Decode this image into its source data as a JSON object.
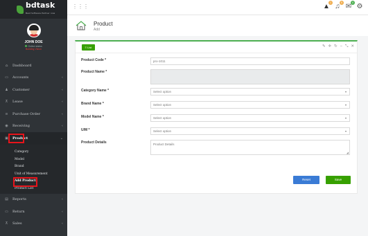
{
  "app": {
    "logo_text": "bdtask",
    "logo_subtext": "Best Software Partner now"
  },
  "profile": {
    "name": "JOHN DOE",
    "status": "Online status",
    "role": "Building Vision"
  },
  "sidebar": {
    "items": [
      {
        "label": "Dashboard",
        "icon": "dashboard-icon",
        "has_arrow": false
      },
      {
        "label": "Accounts",
        "icon": "folder-icon",
        "has_arrow": true
      },
      {
        "label": "Customer",
        "icon": "user-icon",
        "has_arrow": true
      },
      {
        "label": "Lease",
        "icon": "cart-icon",
        "has_arrow": true
      },
      {
        "label": "Purchase Order",
        "icon": "list-icon",
        "has_arrow": true
      },
      {
        "label": "Receiving",
        "icon": "eye-icon",
        "has_arrow": true
      },
      {
        "label": "Product",
        "icon": "briefcase-icon",
        "has_arrow": true
      },
      {
        "label": "Reports",
        "icon": "report-icon",
        "has_arrow": true
      },
      {
        "label": "Return",
        "icon": "return-icon",
        "has_arrow": true
      },
      {
        "label": "Sales",
        "icon": "sales-icon",
        "has_arrow": true
      }
    ],
    "product_submenu": [
      "Category",
      "Model",
      "Brand",
      "Unit of Measurement",
      "Add Product",
      "Product List"
    ]
  },
  "topbar": {
    "badges": [
      "1",
      "5",
      "0"
    ]
  },
  "page": {
    "title": "Product",
    "subtitle": "Add"
  },
  "panel": {
    "list_button": "List",
    "tools": [
      "✎",
      "✛",
      "↻",
      "−",
      "⤡",
      "✕"
    ]
  },
  "form": {
    "product_code": {
      "label": "Product Code *",
      "value": "pro-1011"
    },
    "product_name": {
      "label": "Product Name *",
      "value": ""
    },
    "category": {
      "label": "Category Name *",
      "placeholder": "Select option"
    },
    "brand": {
      "label": "Brand Name *",
      "placeholder": "Select option"
    },
    "model": {
      "label": "Model Name *",
      "placeholder": "Select option"
    },
    "uom": {
      "label": "U/M *",
      "placeholder": "Select option"
    },
    "details": {
      "label": "Product Details",
      "placeholder": "Product Details"
    }
  },
  "buttons": {
    "reset": "Reset",
    "save": "Save"
  },
  "colors": {
    "sidebar_bg": "#2f3337",
    "accent_green": "#37a000",
    "reset_blue": "#3a7bd5",
    "highlight_red": "#e8141b"
  }
}
